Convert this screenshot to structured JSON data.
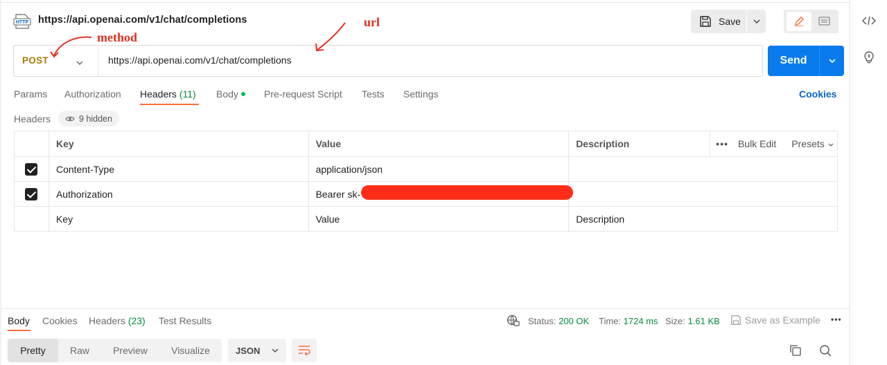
{
  "request": {
    "title": "https://api.openai.com/v1/chat/completions",
    "method": "POST",
    "url": "https://api.openai.com/v1/chat/completions"
  },
  "toolbar": {
    "save_label": "Save",
    "send_label": "Send"
  },
  "tabs": [
    {
      "label": "Params"
    },
    {
      "label": "Authorization"
    },
    {
      "label": "Headers",
      "count": "(11)"
    },
    {
      "label": "Body"
    },
    {
      "label": "Pre-request Script"
    },
    {
      "label": "Tests"
    },
    {
      "label": "Settings"
    }
  ],
  "cookies_link": "Cookies",
  "headers_section": {
    "label": "Headers",
    "hidden_count": "9 hidden",
    "columns": {
      "key": "Key",
      "value": "Value",
      "description": "Description"
    },
    "bulk_edit": "Bulk Edit",
    "presets": "Presets",
    "rows": [
      {
        "key": "Content-Type",
        "value": "application/json",
        "description": "",
        "checked": true
      },
      {
        "key": "Authorization",
        "value": "Bearer sk-",
        "description": "",
        "checked": true,
        "value_redacted": true
      }
    ],
    "placeholder": {
      "key": "Key",
      "value": "Value",
      "description": "Description"
    }
  },
  "response": {
    "tabs": [
      {
        "label": "Body"
      },
      {
        "label": "Cookies"
      },
      {
        "label": "Headers",
        "count": "(23)"
      },
      {
        "label": "Test Results"
      }
    ],
    "status_label": "Status:",
    "status_value": "200 OK",
    "time_label": "Time:",
    "time_value": "1724 ms",
    "size_label": "Size:",
    "size_value": "1.61 KB",
    "save_example": "Save as Example",
    "view_modes": [
      "Pretty",
      "Raw",
      "Preview",
      "Visualize"
    ],
    "format": "JSON"
  },
  "annotations": {
    "method": "method",
    "url": "url"
  },
  "colors": {
    "accent": "#ff6c37",
    "send": "#097bed",
    "method": "#ad7a03",
    "annotation": "#e23120",
    "redaction": "#ff2d17"
  },
  "icons": [
    "http-file-icon",
    "save-icon",
    "chevron-down-icon",
    "pencil-icon",
    "comment-icon",
    "code-icon",
    "lightbulb-icon",
    "eye-icon",
    "globe-icon",
    "copy-icon",
    "search-icon",
    "wrap-icon"
  ]
}
